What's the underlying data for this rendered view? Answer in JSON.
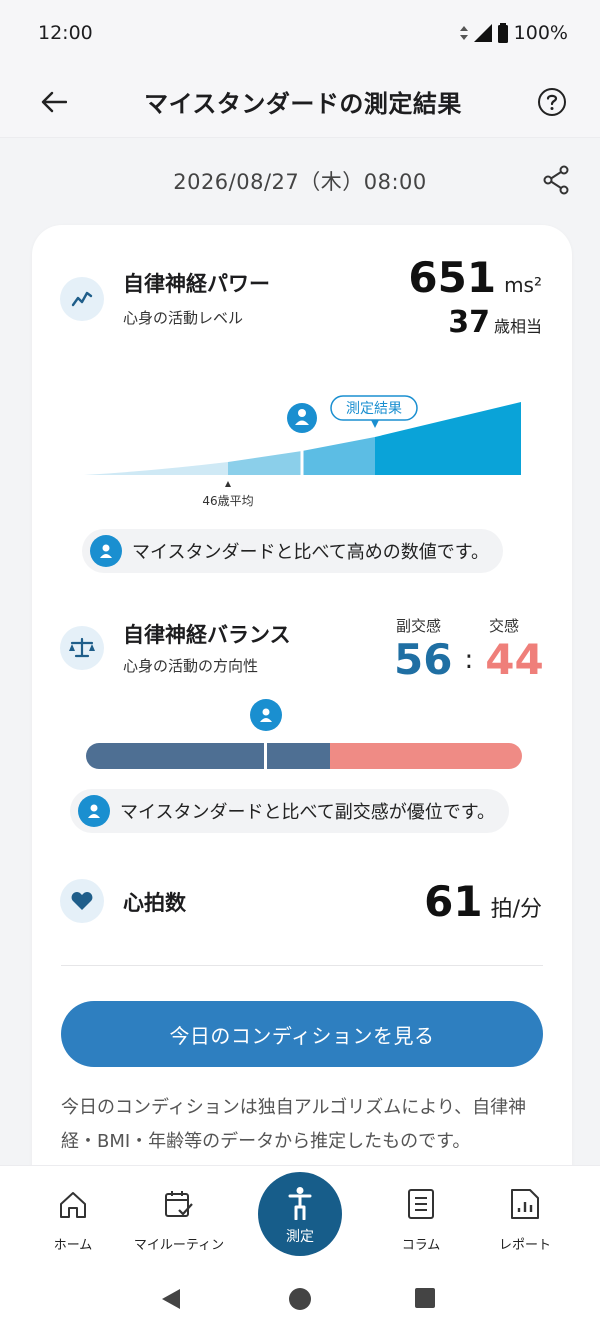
{
  "status_bar": {
    "time": "12:00",
    "battery": "100%"
  },
  "header": {
    "title": "マイスタンダードの測定結果"
  },
  "date": "2026/08/27（木）08:00",
  "power": {
    "title": "自律神経パワー",
    "subtitle": "心身の活動レベル",
    "value": "651",
    "unit": "ms²",
    "age_value": "37",
    "age_unit": "歳相当",
    "result_label": "測定結果",
    "avg_label": "46歳平均",
    "message": "マイスタンダードと比べて高めの数値です。"
  },
  "balance": {
    "title": "自律神経バランス",
    "subtitle": "心身の活動の方向性",
    "para_label": "副交感",
    "sym_label": "交感",
    "para_value": "56",
    "separator": ":",
    "sym_value": "44",
    "para_ratio": 0.56,
    "message": "マイスタンダードと比べて副交感が優位です。"
  },
  "heart": {
    "title": "心拍数",
    "value": "61",
    "unit": "拍/分"
  },
  "cta_label": "今日のコンディションを見る",
  "note": "今日のコンディションは独自アルゴリズムにより、自律神経・BMI・年齢等のデータから推定したものです。",
  "nav": [
    {
      "label": "ホーム"
    },
    {
      "label": "マイルーティン"
    },
    {
      "label": "測定"
    },
    {
      "label": "コラム"
    },
    {
      "label": "レポート"
    }
  ],
  "colors": {
    "primary": "#2e7fc0",
    "accent_cyan": "#0aa3d8",
    "parasympathetic": "#1f6fa3",
    "sympathetic": "#ef7f7a",
    "balance_left": "#4e6f93",
    "balance_right": "#ef8b85"
  }
}
